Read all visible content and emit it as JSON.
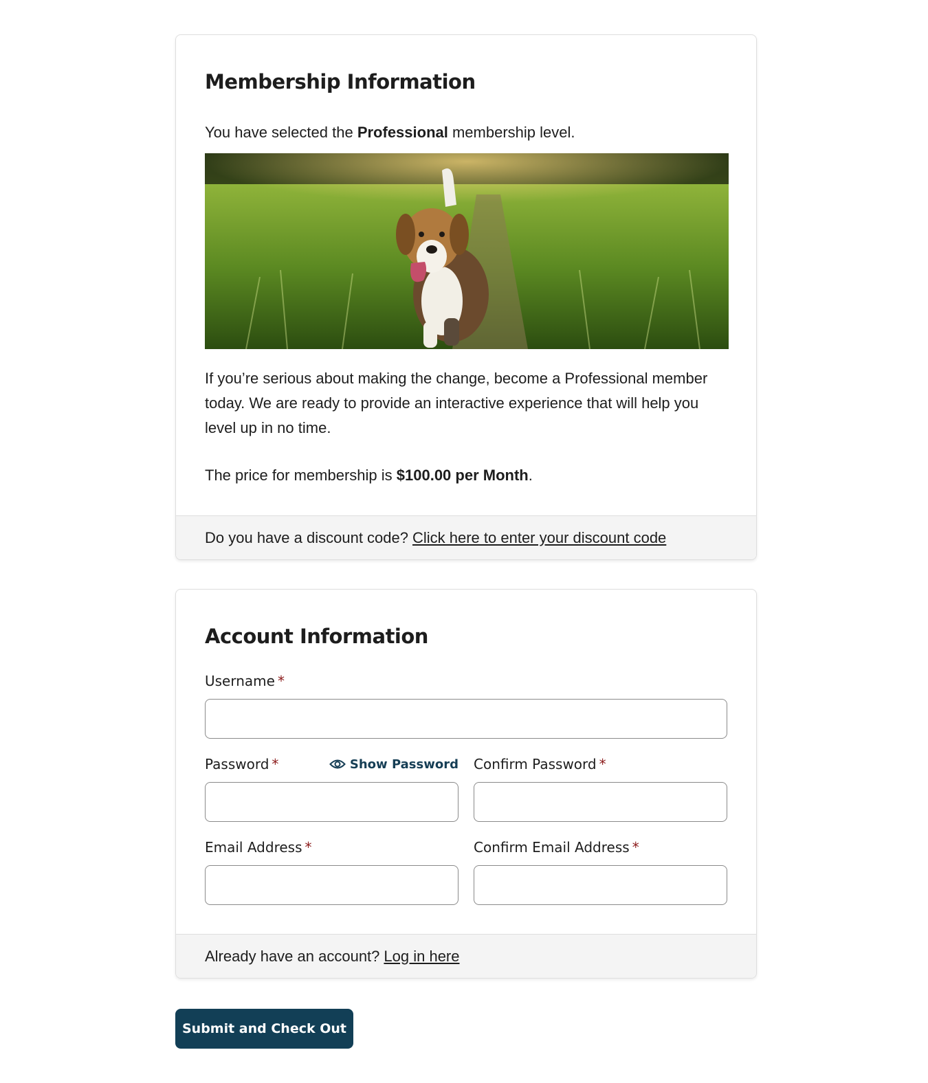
{
  "membership": {
    "title": "Membership Information",
    "selected_prefix": "You have selected the ",
    "level": "Professional",
    "selected_suffix": " membership level.",
    "description": "If you’re serious about making the change, become a Professional member today. We are ready to provide an interactive experience that will help you level up in no time.",
    "price_prefix": "The price for membership is ",
    "price": "$100.00 per Month",
    "price_suffix": ".",
    "discount_question": "Do you have a discount code?",
    "discount_link": "Click here to enter your discount code"
  },
  "account": {
    "title": "Account Information",
    "username_label": "Username",
    "password_label": "Password",
    "show_password": "Show Password",
    "confirm_password_label": "Confirm Password",
    "email_label": "Email Address",
    "confirm_email_label": "Confirm Email Address",
    "required_mark": "*",
    "login_question": "Already have an account?",
    "login_link": "Log in here"
  },
  "submit_label": "Submit and Check Out",
  "colors": {
    "button": "#123f56",
    "link_accent": "#163e55",
    "required": "#8b1a1a",
    "footer_bg": "#f4f4f4"
  }
}
